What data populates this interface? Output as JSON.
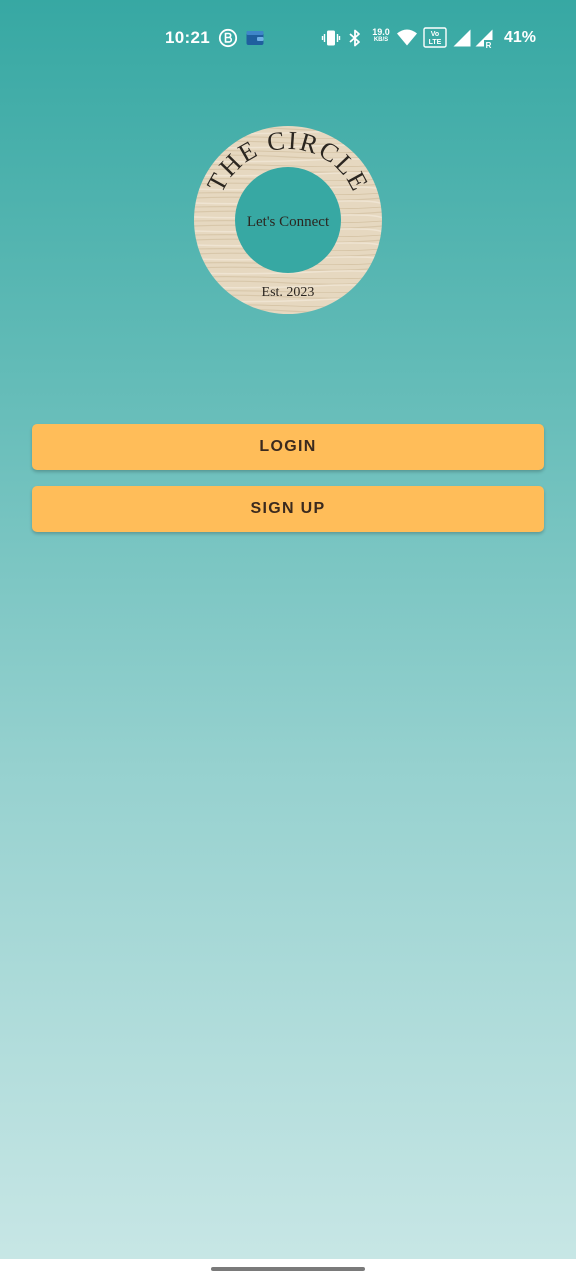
{
  "status_bar": {
    "time": "10:21",
    "network_speed_value": "19.0",
    "network_speed_unit": "KB/S",
    "volte_label": "Vo LTE",
    "roaming_label": "R",
    "battery": "41%",
    "icons": [
      "b-circle-icon",
      "wallet-icon",
      "vibrate-icon",
      "bluetooth-icon",
      "wifi-icon",
      "volte-icon",
      "signal-icon",
      "signal-roaming-icon"
    ]
  },
  "logo": {
    "top_text": "THE CIRCLE",
    "center_text": "Let's Connect",
    "bottom_text": "Est. 2023",
    "ring_color": "#e9dcc6",
    "center_color": "#37a8a3"
  },
  "actions": {
    "login_label": "LOGIN",
    "signup_label": "SIGN UP"
  },
  "colors": {
    "button": "#ffbd59",
    "button_text": "#3b2a1e",
    "gradient_top": "#37a8a3",
    "gradient_bottom": "#c9e7e6"
  }
}
